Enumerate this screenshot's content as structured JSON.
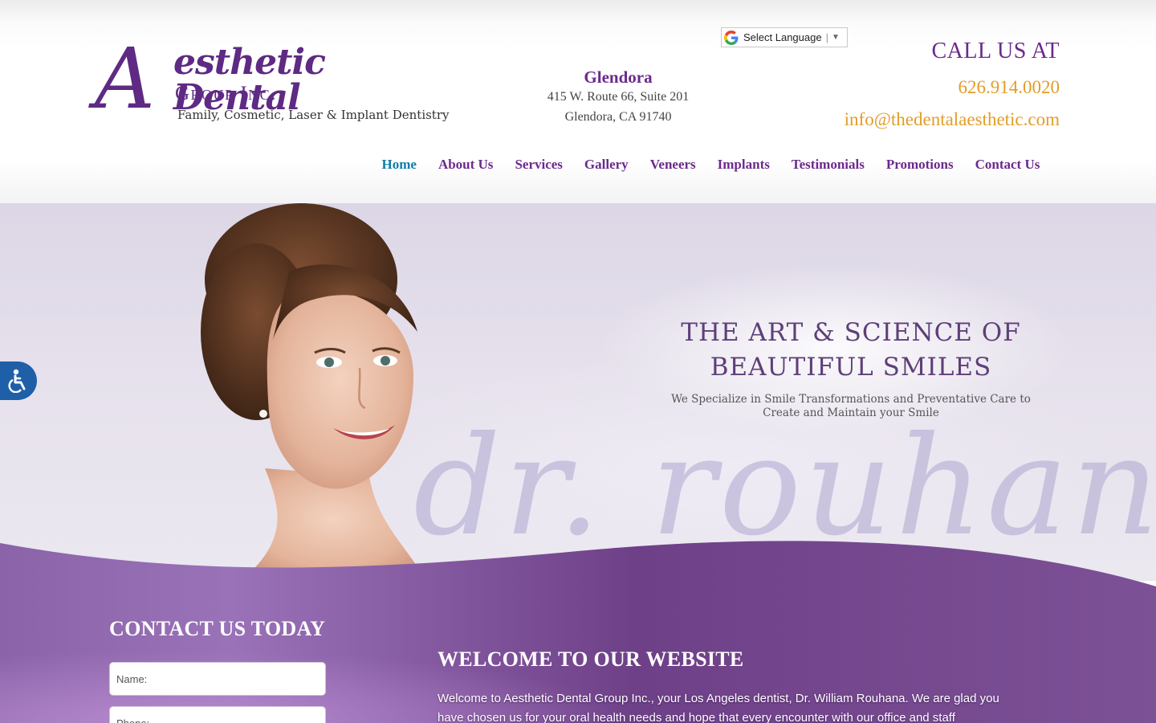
{
  "logo": {
    "letter": "A",
    "script": "esthetic Dental",
    "group": "Group Inc.",
    "tagline": "Family, Cosmetic, Laser & Implant Dentistry"
  },
  "location": {
    "name": "Glendora",
    "line1": "415 W. Route 66, Suite 201",
    "line2": "Glendora, CA 91740"
  },
  "language": {
    "label": "Select Language",
    "arrow": "▼"
  },
  "contact_header": {
    "call_label": "CALL US AT",
    "phone": "626.914.0020",
    "email": "info@thedentalaesthetic.com"
  },
  "nav": {
    "items": [
      {
        "label": "Home",
        "active": true
      },
      {
        "label": "About Us"
      },
      {
        "label": "Services"
      },
      {
        "label": "Gallery"
      },
      {
        "label": "Veneers"
      },
      {
        "label": "Implants"
      },
      {
        "label": "Testimonials"
      },
      {
        "label": "Promotions"
      },
      {
        "label": "Contact Us"
      }
    ]
  },
  "hero": {
    "headline_line1": "THE ART & SCIENCE OF",
    "headline_line2": "BEAUTIFUL SMILES",
    "subline1": "We Specialize in Smile Transformations and Preventative Care to",
    "subline2": "Create and Maintain your Smile",
    "watermark": "dr. rouhana"
  },
  "contact_form": {
    "title": "CONTACT US TODAY",
    "name_placeholder": "Name:",
    "phone_placeholder": "Phone:"
  },
  "welcome": {
    "title": "WELCOME TO OUR WEBSITE",
    "text": "Welcome to Aesthetic Dental Group Inc., your Los Angeles dentist, Dr. William Rouhana. We are glad you have chosen us for your oral health needs and hope that every encounter with our office and staff exceeds your"
  },
  "colors": {
    "brand_purple": "#6b2a8c",
    "accent_orange": "#e39d28",
    "active_nav": "#0f7fa4",
    "accessibility_blue": "#1f5fa8"
  },
  "icons": {
    "language": "google-g-icon",
    "accessibility": "accessibility-icon"
  }
}
